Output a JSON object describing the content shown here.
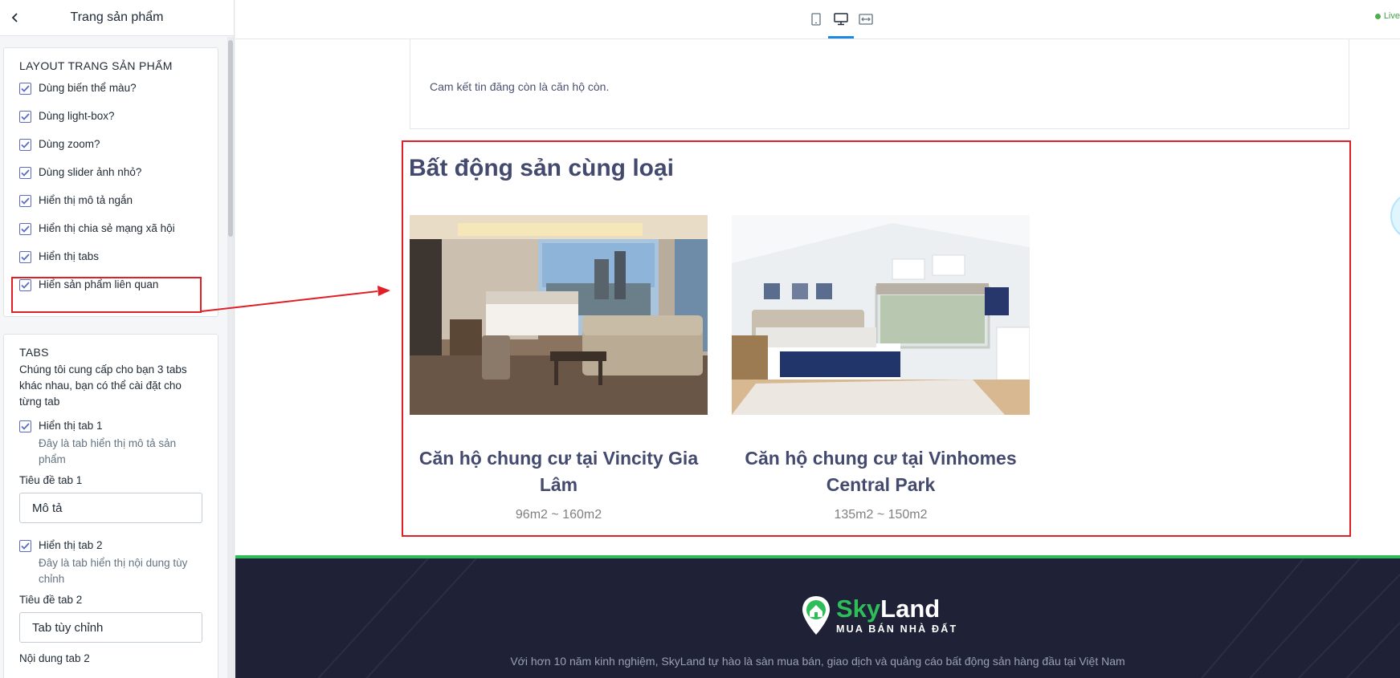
{
  "sidebar": {
    "title": "Trang sản phẩm",
    "layout_section": {
      "title": "LAYOUT TRANG SẢN PHẨM",
      "options": [
        {
          "label": "Dùng biến thể màu?",
          "checked": true
        },
        {
          "label": "Dùng light-box?",
          "checked": true
        },
        {
          "label": "Dùng zoom?",
          "checked": true
        },
        {
          "label": "Dùng slider ảnh nhỏ?",
          "checked": true
        },
        {
          "label": "Hiển thị mô tả ngắn",
          "checked": true
        },
        {
          "label": "Hiển thị chia sẻ mạng xã hội",
          "checked": true
        },
        {
          "label": "Hiển thị tabs",
          "checked": true
        },
        {
          "label": "Hiển sản phẩm liên quan",
          "checked": true
        }
      ]
    },
    "tabs_section": {
      "title": "TABS",
      "description": "Chúng tôi cung cấp cho bạn 3 tabs khác nhau, bạn có thể cài đặt cho từng tab",
      "tab1_toggle": "Hiển thị tab 1",
      "tab1_desc": "Đây là tab hiển thị mô tả sản phẩm",
      "tab1_title_label": "Tiêu đề tab 1",
      "tab1_title_value": "Mô tả",
      "tab2_toggle": "Hiển thị tab 2",
      "tab2_desc": "Đây là tab hiển thị nội dung tùy chỉnh",
      "tab2_title_label": "Tiêu đề tab 2",
      "tab2_title_value": "Tab tùy chỉnh",
      "tab2_content_label": "Nội dung tab 2"
    }
  },
  "toolbar": {
    "live_label": "Live"
  },
  "preview": {
    "commit_text": "Cam kết tin đăng còn là căn hộ còn.",
    "related_title": "Bất động sản cùng loại",
    "products": [
      {
        "name": "Căn hộ chung cư tại Vincity Gia Lâm",
        "area": "96m2 ~ 160m2"
      },
      {
        "name": "Căn hộ chung cư tại Vinhomes Central Park",
        "area": "135m2 ~ 150m2"
      }
    ]
  },
  "footer": {
    "logo_sky": "Sky",
    "logo_land": "Land",
    "logo_tagline": "MUA BÁN NHÀ ĐẤT",
    "intro": "Với hơn 10 năm kinh nghiệm, SkyLand tự hào là sàn mua bán, giao dịch và quảng cáo bất động sản hàng đầu tại Việt Nam"
  },
  "colors": {
    "accent_blue": "#1e88e5",
    "checkbox": "#5c6ac4",
    "highlight_red": "#e01f26",
    "brand_green": "#2ebd59",
    "footer_bg": "#1f2236",
    "heading": "#434a6e"
  }
}
